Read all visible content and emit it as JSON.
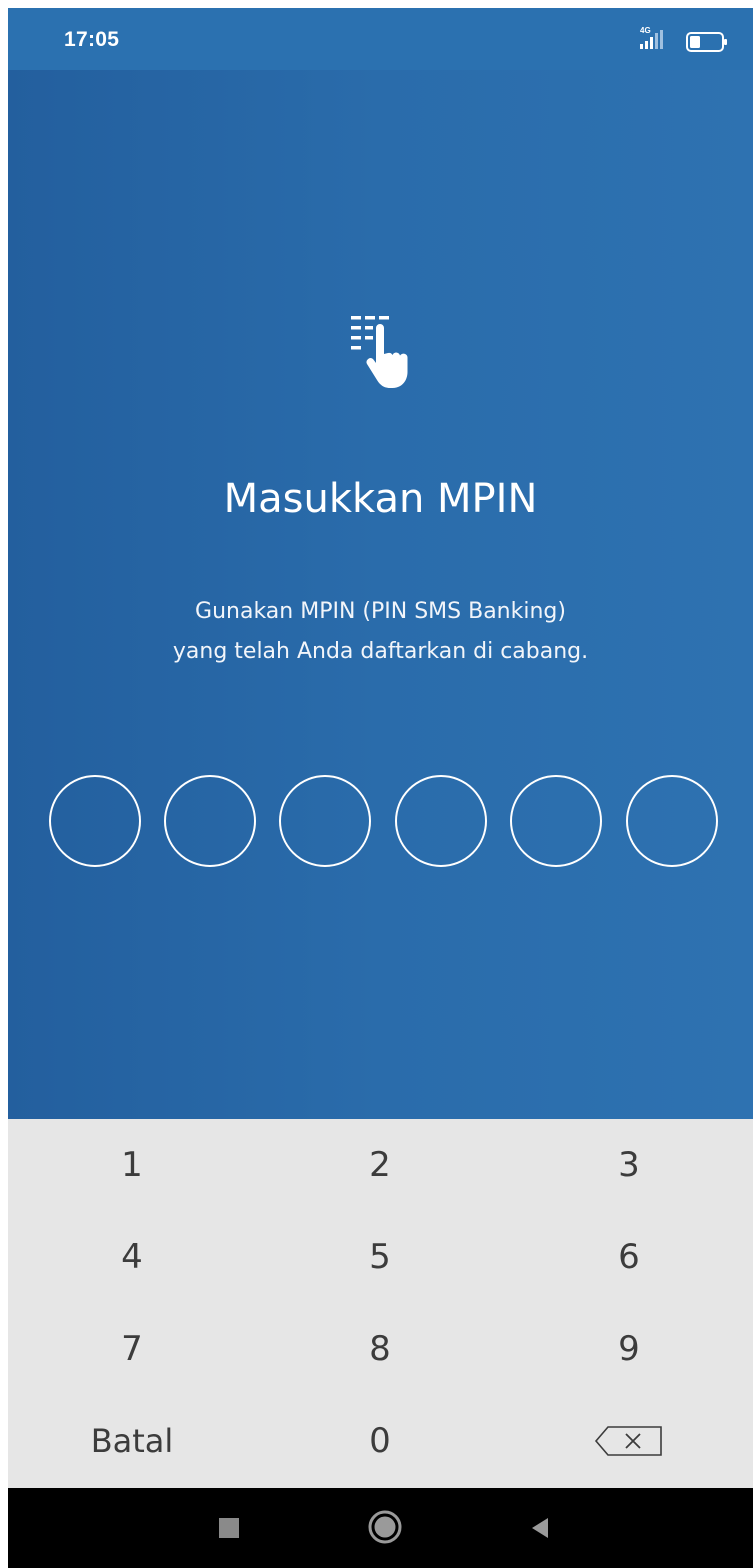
{
  "status_bar": {
    "time": "17:05",
    "network": "4G"
  },
  "header": {
    "icon": "touch-keypad-icon",
    "title": "Masukkan MPIN",
    "subtitle_lines": [
      "Gunakan MPIN (PIN SMS Banking)",
      "yang telah Anda daftarkan di cabang."
    ]
  },
  "pin": {
    "length": 6,
    "filled": 0
  },
  "keypad": {
    "rows": [
      [
        "1",
        "2",
        "3"
      ],
      [
        "4",
        "5",
        "6"
      ],
      [
        "7",
        "8",
        "9"
      ]
    ],
    "cancel_label": "Batal",
    "zero_label": "0",
    "backspace_icon": "backspace-icon"
  },
  "nav_bar": {
    "icons": [
      "recents-icon",
      "home-icon",
      "back-icon"
    ]
  },
  "colors": {
    "panel_blue": "#2a6cab",
    "status_blue": "#2b71b0",
    "keypad_bg": "#e6e6e6",
    "key_text": "#3c3c3c"
  }
}
